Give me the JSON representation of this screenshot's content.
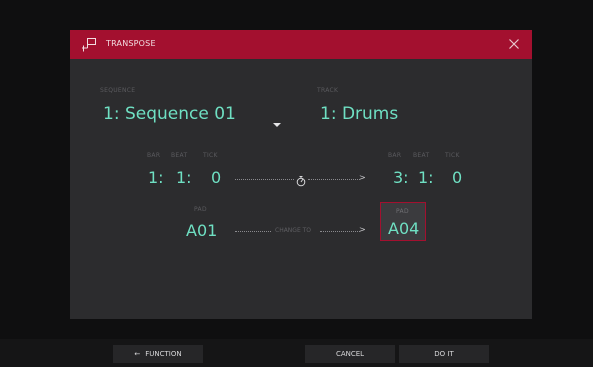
{
  "dialog": {
    "title": "TRANSPOSE",
    "sequence_label": "SEQUENCE",
    "sequence_value": "1: Sequence 01",
    "track_label": "TRACK",
    "track_value": "1: Drums",
    "start": {
      "bar_label": "BAR",
      "beat_label": "BEAT",
      "tick_label": "TICK",
      "bar": "1:",
      "beat": "1:",
      "tick": "0"
    },
    "end": {
      "bar_label": "BAR",
      "beat_label": "BEAT",
      "tick_label": "TICK",
      "bar": "3:",
      "beat": "1:",
      "tick": "0"
    },
    "pad_label": "PAD",
    "pad_value": "A01",
    "change_to_label": "CHANGE TO",
    "target_pad_label": "PAD",
    "target_pad_value": "A04"
  },
  "footer": {
    "function_label": "FUNCTION",
    "cancel_label": "CANCEL",
    "doit_label": "DO IT"
  },
  "colors": {
    "accent": "#a3102f",
    "value_text": "#6fe0c3",
    "panel": "#2c2c2e"
  }
}
